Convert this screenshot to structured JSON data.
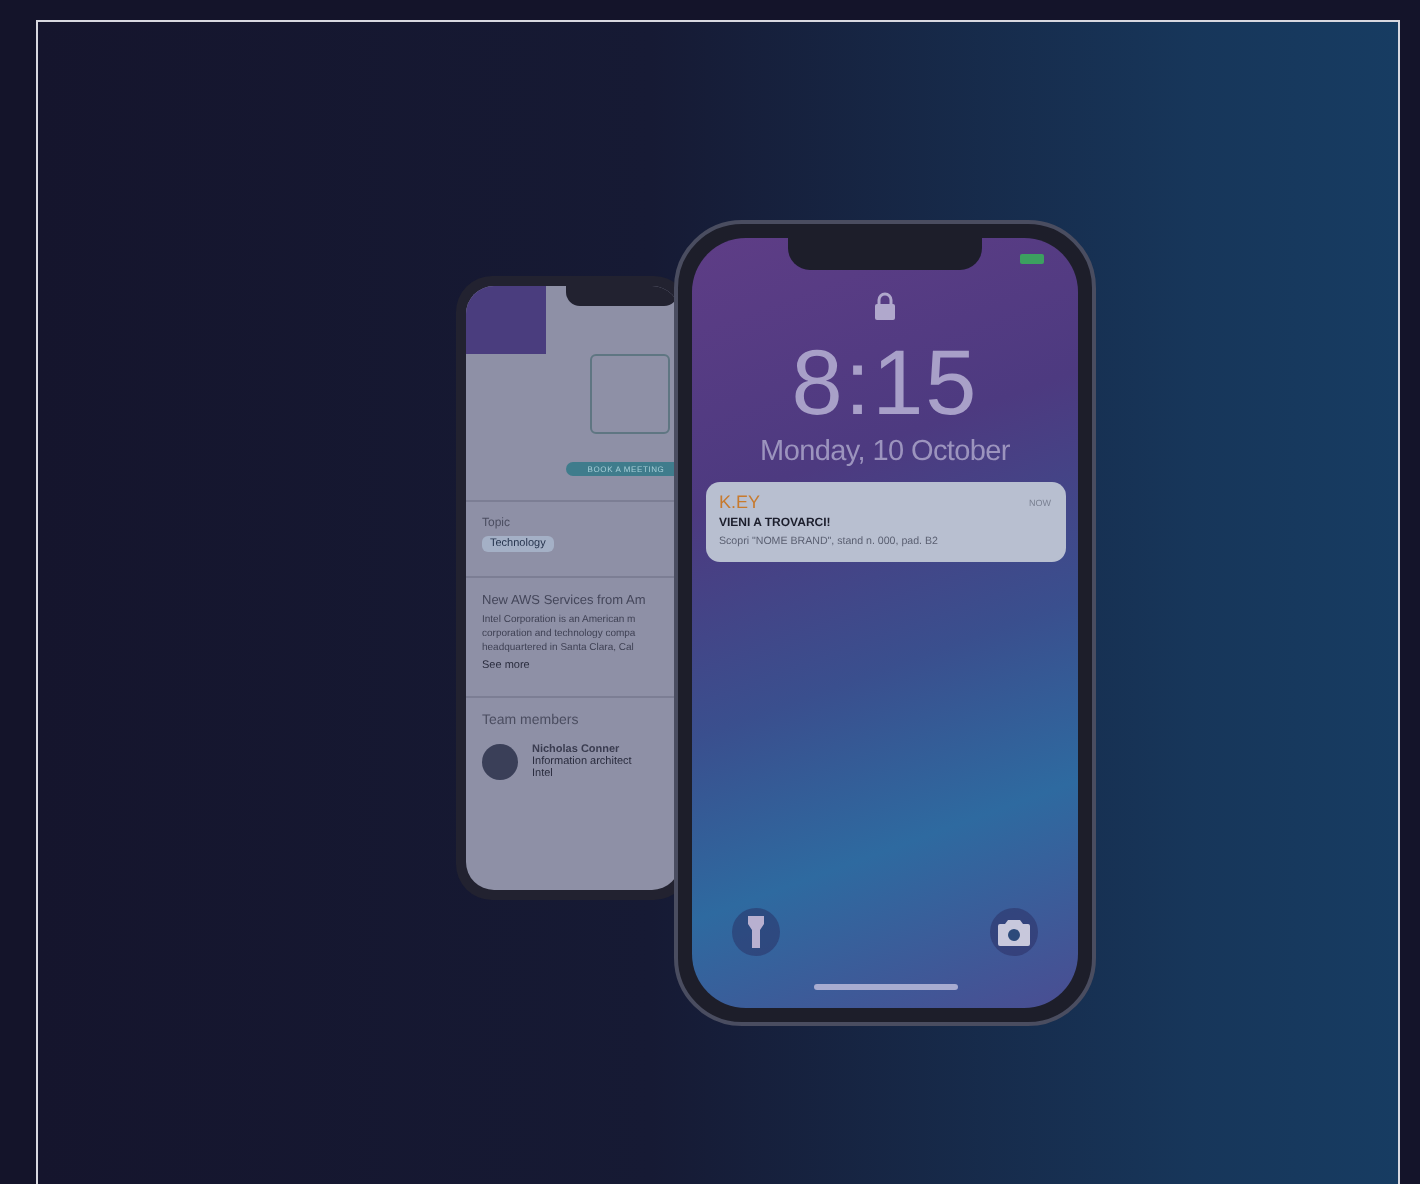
{
  "back_phone": {
    "button": "BOOK A MEETING",
    "topic_label": "Topic",
    "topic_tag": "Technology",
    "article_title": "New AWS Services from Am",
    "article_lines": [
      "Intel Corporation is an American m",
      "corporation and technology compa",
      "headquartered in Santa Clara, Cal"
    ],
    "see_more": "See more",
    "team_title": "Team members",
    "members": [
      {
        "name": "Nicholas Conner",
        "role": "Information architect",
        "company": "Intel"
      }
    ]
  },
  "lock_screen": {
    "time": "8:15",
    "date": "Monday, 10 October",
    "notification": {
      "app": "K.EY",
      "time": "NOW",
      "title": "VIENI A TROVARCI!",
      "body": "Scopri \"NOME BRAND\", stand n. 000, pad. B2"
    }
  }
}
